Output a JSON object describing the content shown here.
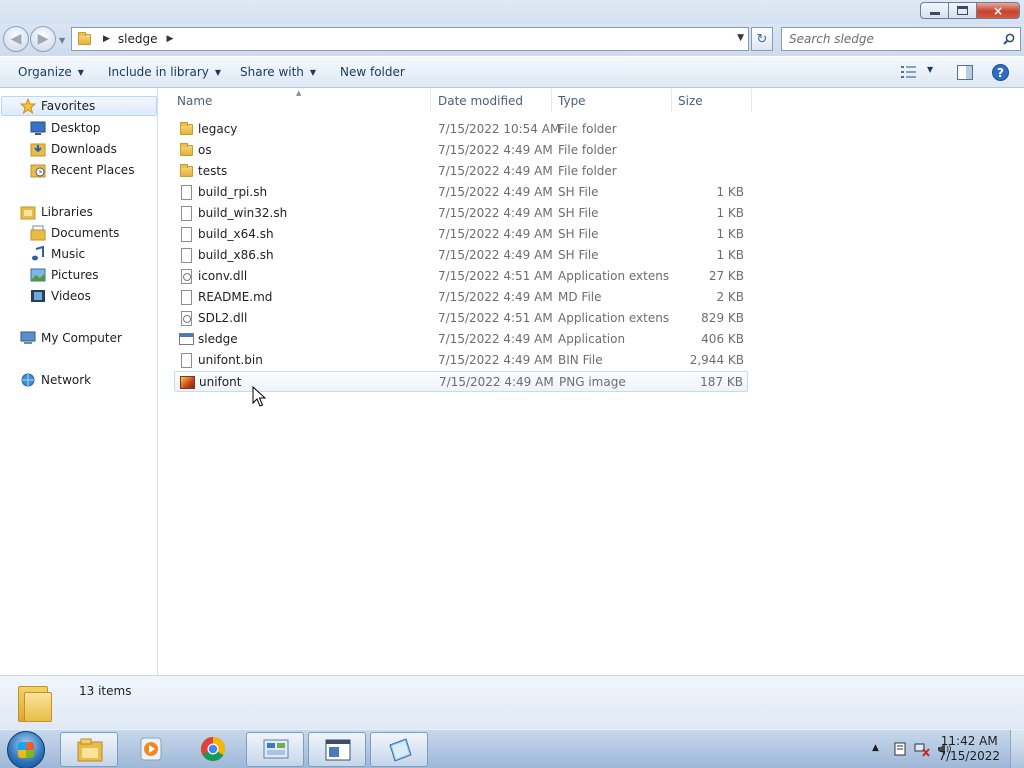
{
  "window": {
    "caption_buttons": {
      "minimize": "minimize",
      "maximize": "restore",
      "close": "×"
    }
  },
  "address": {
    "crumbs": [
      "sledge"
    ],
    "search_placeholder": "Search sledge"
  },
  "toolbar": {
    "organize": "Organize",
    "include_in_library": "Include in library",
    "share_with": "Share with",
    "new_folder": "New folder"
  },
  "nav": {
    "favorites": {
      "label": "Favorites",
      "items": [
        {
          "label": "Desktop",
          "icon": "desktop-icon"
        },
        {
          "label": "Downloads",
          "icon": "downloads-icon"
        },
        {
          "label": "Recent Places",
          "icon": "recent-places-icon"
        }
      ]
    },
    "libraries": {
      "label": "Libraries",
      "items": [
        {
          "label": "Documents",
          "icon": "documents-icon"
        },
        {
          "label": "Music",
          "icon": "music-icon"
        },
        {
          "label": "Pictures",
          "icon": "pictures-icon"
        },
        {
          "label": "Videos",
          "icon": "videos-icon"
        }
      ]
    },
    "computer": {
      "label": "My Computer",
      "icon": "computer-icon"
    },
    "network": {
      "label": "Network",
      "icon": "network-icon"
    }
  },
  "columns": {
    "name": "Name",
    "date": "Date modified",
    "type": "Type",
    "size": "Size"
  },
  "files": [
    {
      "name": "legacy",
      "date": "7/15/2022 10:54 AM",
      "type": "File folder",
      "size": "",
      "icon": "folder-icon"
    },
    {
      "name": "os",
      "date": "7/15/2022 4:49 AM",
      "type": "File folder",
      "size": "",
      "icon": "folder-icon"
    },
    {
      "name": "tests",
      "date": "7/15/2022 4:49 AM",
      "type": "File folder",
      "size": "",
      "icon": "folder-icon"
    },
    {
      "name": "build_rpi.sh",
      "date": "7/15/2022 4:49 AM",
      "type": "SH File",
      "size": "1 KB",
      "icon": "file-icon"
    },
    {
      "name": "build_win32.sh",
      "date": "7/15/2022 4:49 AM",
      "type": "SH File",
      "size": "1 KB",
      "icon": "file-icon"
    },
    {
      "name": "build_x64.sh",
      "date": "7/15/2022 4:49 AM",
      "type": "SH File",
      "size": "1 KB",
      "icon": "file-icon"
    },
    {
      "name": "build_x86.sh",
      "date": "7/15/2022 4:49 AM",
      "type": "SH File",
      "size": "1 KB",
      "icon": "file-icon"
    },
    {
      "name": "iconv.dll",
      "date": "7/15/2022 4:51 AM",
      "type": "Application extens...",
      "size": "27 KB",
      "icon": "dll-icon"
    },
    {
      "name": "README.md",
      "date": "7/15/2022 4:49 AM",
      "type": "MD File",
      "size": "2 KB",
      "icon": "file-icon"
    },
    {
      "name": "SDL2.dll",
      "date": "7/15/2022 4:51 AM",
      "type": "Application extens...",
      "size": "829 KB",
      "icon": "dll-icon"
    },
    {
      "name": "sledge",
      "date": "7/15/2022 4:49 AM",
      "type": "Application",
      "size": "406 KB",
      "icon": "application-icon"
    },
    {
      "name": "unifont.bin",
      "date": "7/15/2022 4:49 AM",
      "type": "BIN File",
      "size": "2,944 KB",
      "icon": "file-icon"
    },
    {
      "name": "unifont",
      "date": "7/15/2022 4:49 AM",
      "type": "PNG image",
      "size": "187 KB",
      "icon": "png-image-icon"
    }
  ],
  "status": {
    "item_count": "13 items"
  },
  "taskbar": {
    "clock_time": "11:42 AM",
    "clock_date": "7/15/2022",
    "apps": [
      "explorer-icon",
      "media-player-icon",
      "chrome-icon",
      "control-panel-icon",
      "app-window-icon",
      "notepad-icon"
    ]
  },
  "colors": {
    "accent": "#1e395b",
    "selection": "#dcebfc",
    "taskbar": "#b3c9e3"
  }
}
